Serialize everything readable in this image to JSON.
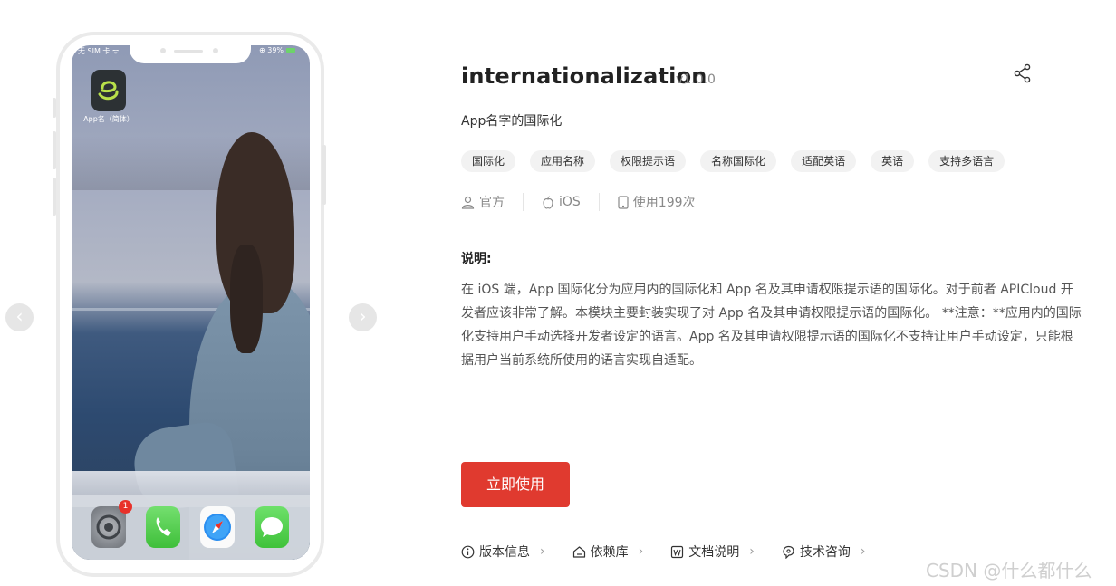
{
  "preview": {
    "status_left": "无 SIM 卡 ᯤ",
    "status_right": "⊕ 39%",
    "app_label": "App名（简体）",
    "dock_badge": "1",
    "prev_icon": "chevron-left-icon",
    "next_icon": "chevron-right-icon"
  },
  "module": {
    "title": "internationalization",
    "version": "v1.0.0",
    "subtitle": "App名字的国际化",
    "tags": [
      "国际化",
      "应用名称",
      "权限提示语",
      "名称国际化",
      "适配英语",
      "英语",
      "支持多语言"
    ],
    "meta": {
      "author": "官方",
      "platform": "iOS",
      "usage": "使用199次"
    },
    "description_title": "说明:",
    "description": "在 iOS 端，App 国际化分为应用内的国际化和 App 名及其申请权限提示语的国际化。对于前者 APICloud 开发者应该非常了解。本模块主要封装实现了对 App 名及其申请权限提示语的国际化。 **注意：**应用内的国际化支持用户手动选择开发者设定的语言。App 名及其申请权限提示语的国际化不支持让用户手动设定，只能根据用户当前系统所使用的语言实现自适配。",
    "use_button": "立即使用",
    "links": [
      "版本信息",
      "依赖库",
      "文档说明",
      "技术咨询"
    ]
  },
  "watermark": "CSDN @什么都什么",
  "colors": {
    "primary": "#e03a2f",
    "tag_bg": "#f2f2f2",
    "muted": "#888888"
  }
}
